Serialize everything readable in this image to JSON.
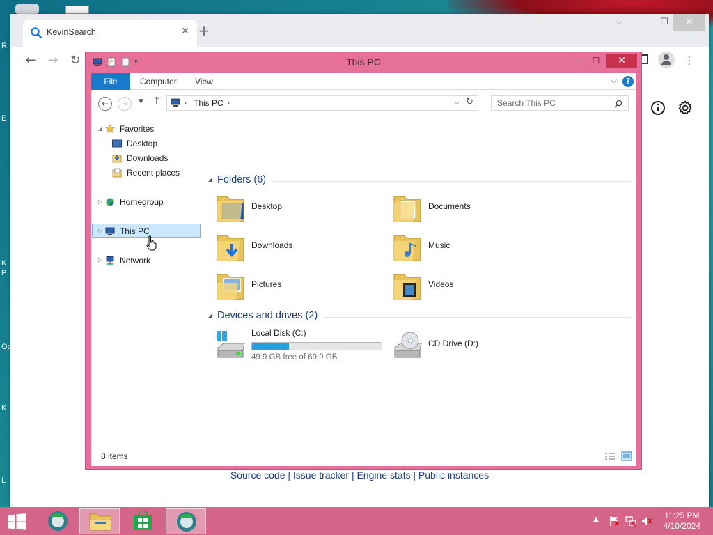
{
  "desktop": {
    "edge_labels": [
      "R",
      "E",
      "K",
      "P",
      "Op",
      "K",
      "L"
    ]
  },
  "browser": {
    "tab": {
      "title": "KevinSearch",
      "close": "✕"
    },
    "newtab": "+",
    "controls": {
      "collapse": "⌵",
      "minimize": "—",
      "maximize": "☐",
      "close": "✕"
    },
    "nav": {
      "back": "←",
      "forward": "→",
      "reload": "↻"
    },
    "page_icons": {
      "menu": "⋮"
    },
    "footer_links": "Source code | Issue tracker | Engine stats | Public instances"
  },
  "explorer": {
    "title": "This PC",
    "ribbon": {
      "file": "File",
      "computer": "Computer",
      "view": "View",
      "help": "?"
    },
    "address": {
      "location": "This PC",
      "separator": "›"
    },
    "search_placeholder": "Search This PC",
    "nav": {
      "favorites": "Favorites",
      "desktop": "Desktop",
      "downloads": "Downloads",
      "recent": "Recent places",
      "homegroup": "Homegroup",
      "thispc": "This PC",
      "network": "Network"
    },
    "folders_header": "Folders (6)",
    "folders": [
      "Desktop",
      "Documents",
      "Downloads",
      "Music",
      "Pictures",
      "Videos"
    ],
    "devices_header": "Devices and drives (2)",
    "drives": {
      "c": {
        "name": "Local Disk (C:)",
        "free": "49.9 GB free of 69.9 GB",
        "used_fraction": 0.286
      },
      "d": {
        "name": "CD Drive (D:)"
      }
    },
    "status": "8 items"
  },
  "taskbar": {
    "clock": {
      "time": "11:25 PM",
      "date": "4/10/2024"
    }
  },
  "colors": {
    "explorer_frame": "#e7709b",
    "taskbar": "#d46488",
    "accent_blue": "#1979ca",
    "drive_fill": "#26a0da"
  }
}
